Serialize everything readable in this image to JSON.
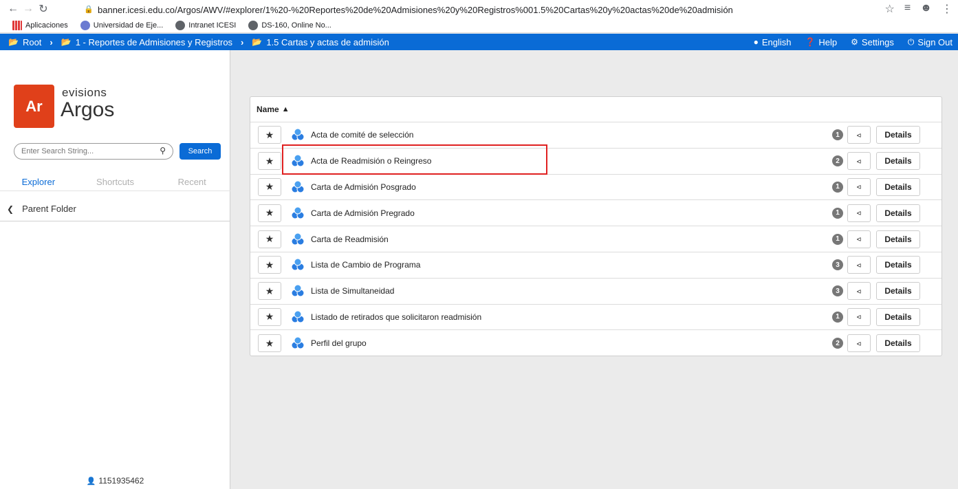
{
  "browser": {
    "url": "banner.icesi.edu.co/Argos/AWV/#explorer/1%20-%20Reportes%20de%20Admisiones%20y%20Registros%001.5%20Cartas%20y%20actas%20de%20admisión",
    "bookmarks": [
      {
        "label": "Aplicaciones",
        "icon": "apps-grid-icon"
      },
      {
        "label": "Universidad de Eje...",
        "icon": "university-icon"
      },
      {
        "label": "Intranet ICESI",
        "icon": "globe-icon"
      },
      {
        "label": "DS-160, Online No...",
        "icon": "globe-icon"
      }
    ]
  },
  "topbar": {
    "crumbs": [
      "Root",
      "1 - Reportes de Admisiones y Registros",
      "1.5 Cartas y actas de admisión"
    ],
    "actions": [
      "English",
      "Help",
      "Settings",
      "Sign Out"
    ]
  },
  "sidebar": {
    "logo_mark": "Ar",
    "logo_brand": "evisions",
    "logo_product": "Argos",
    "search_placeholder": "Enter Search String...",
    "search_button": "Search",
    "tabs": [
      "Explorer",
      "Shortcuts",
      "Recent"
    ],
    "parent_folder": "Parent Folder",
    "user_id": "1151935462"
  },
  "list": {
    "header": "Name",
    "items": [
      {
        "label": "Acta de comité de selección",
        "count": "1"
      },
      {
        "label": "Acta de Readmisión o Reingreso",
        "count": "2"
      },
      {
        "label": "Carta de Admisión Posgrado",
        "count": "1"
      },
      {
        "label": "Carta de Admisión Pregrado",
        "count": "1"
      },
      {
        "label": "Carta de Readmisión",
        "count": "1"
      },
      {
        "label": "Lista de Cambio de Programa",
        "count": "3"
      },
      {
        "label": "Lista de Simultaneidad",
        "count": "3"
      },
      {
        "label": "Listado de retirados que solicitaron readmisión",
        "count": "1"
      },
      {
        "label": "Perfil del grupo",
        "count": "2"
      }
    ],
    "details_label": "Details"
  },
  "colors": {
    "accent": "#0a6bd6",
    "logo": "#e0401a",
    "highlight": "#e02020"
  }
}
